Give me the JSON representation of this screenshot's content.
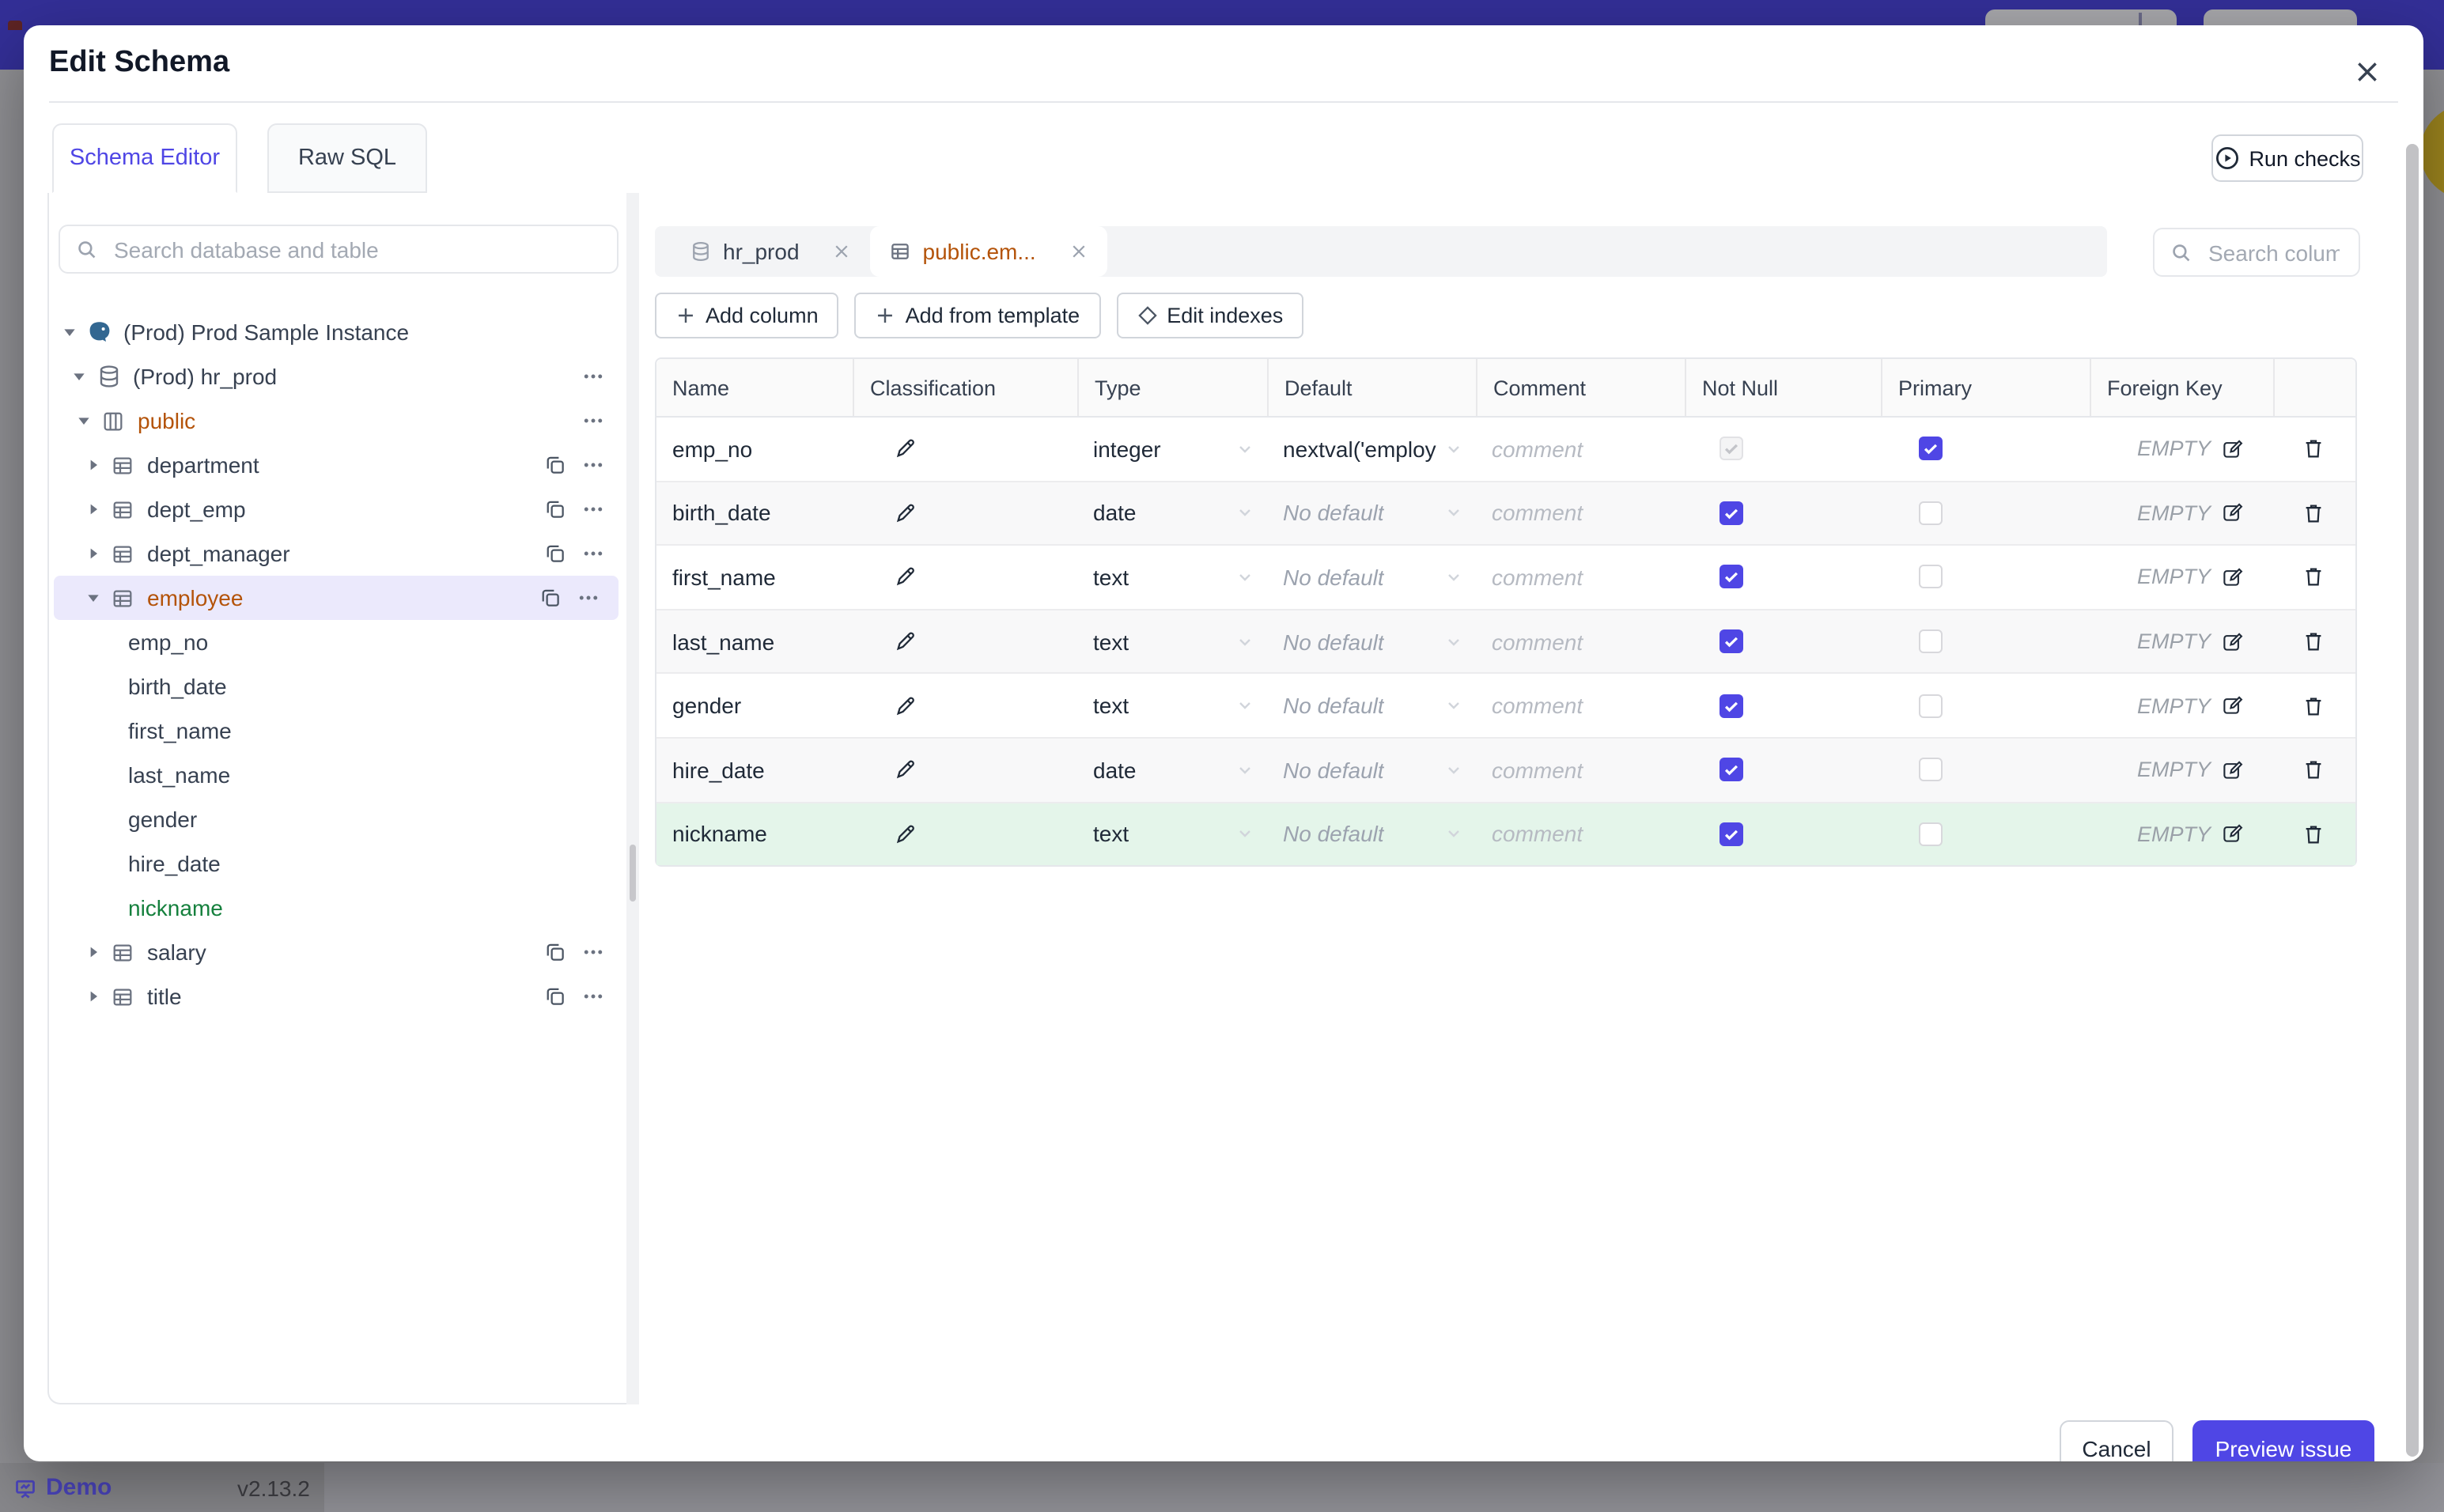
{
  "colors": {
    "accent": "#4f46e5",
    "modified_orange": "#b45309",
    "created_green": "#15803d",
    "topbar": "#332f97"
  },
  "modal": {
    "title": "Edit Schema",
    "tabs": {
      "schema_editor": "Schema Editor",
      "raw_sql": "Raw SQL"
    },
    "run_checks_label": "Run checks",
    "sidebar": {
      "search_placeholder": "Search database and table",
      "tree": [
        {
          "label": "(Prod) Prod Sample Instance"
        },
        {
          "label": "(Prod) hr_prod"
        },
        {
          "label": "public"
        },
        {
          "label": "department"
        },
        {
          "label": "dept_emp"
        },
        {
          "label": "dept_manager"
        },
        {
          "label": "employee"
        },
        {
          "label": "emp_no"
        },
        {
          "label": "birth_date"
        },
        {
          "label": "first_name"
        },
        {
          "label": "last_name"
        },
        {
          "label": "gender"
        },
        {
          "label": "hire_date"
        },
        {
          "label": "nickname"
        },
        {
          "label": "salary"
        },
        {
          "label": "title"
        }
      ]
    },
    "editor": {
      "chips": [
        {
          "label": "hr_prod"
        },
        {
          "label": "public.em..."
        }
      ],
      "column_search_placeholder": "Search column",
      "toolbar": {
        "add_column": "Add column",
        "add_from_template": "Add from template",
        "edit_indexes": "Edit indexes"
      },
      "table": {
        "headers": [
          "Name",
          "Classification",
          "Type",
          "Default",
          "Comment",
          "Not Null",
          "Primary",
          "Foreign Key"
        ],
        "rows": [
          {
            "name": "emp_no",
            "type": "integer",
            "default": "nextval('employ",
            "comment": "comment",
            "foreign_key": "EMPTY",
            "not_null": true,
            "not_null_disabled": true,
            "primary": true,
            "new": false
          },
          {
            "name": "birth_date",
            "type": "date",
            "default": "No default",
            "comment": "comment",
            "foreign_key": "EMPTY",
            "not_null": true,
            "not_null_disabled": false,
            "primary": false,
            "new": false
          },
          {
            "name": "first_name",
            "type": "text",
            "default": "No default",
            "comment": "comment",
            "foreign_key": "EMPTY",
            "not_null": true,
            "not_null_disabled": false,
            "primary": false,
            "new": false
          },
          {
            "name": "last_name",
            "type": "text",
            "default": "No default",
            "comment": "comment",
            "foreign_key": "EMPTY",
            "not_null": true,
            "not_null_disabled": false,
            "primary": false,
            "new": false
          },
          {
            "name": "gender",
            "type": "text",
            "default": "No default",
            "comment": "comment",
            "foreign_key": "EMPTY",
            "not_null": true,
            "not_null_disabled": false,
            "primary": false,
            "new": false
          },
          {
            "name": "hire_date",
            "type": "date",
            "default": "No default",
            "comment": "comment",
            "foreign_key": "EMPTY",
            "not_null": true,
            "not_null_disabled": false,
            "primary": false,
            "new": false
          },
          {
            "name": "nickname",
            "type": "text",
            "default": "No default",
            "comment": "comment",
            "foreign_key": "EMPTY",
            "not_null": true,
            "not_null_disabled": false,
            "primary": false,
            "new": true
          }
        ]
      }
    },
    "actions": {
      "cancel": "Cancel",
      "preview_issue": "Preview issue"
    }
  },
  "page_footer": {
    "demo_label": "Demo",
    "version": "v2.13.2"
  }
}
